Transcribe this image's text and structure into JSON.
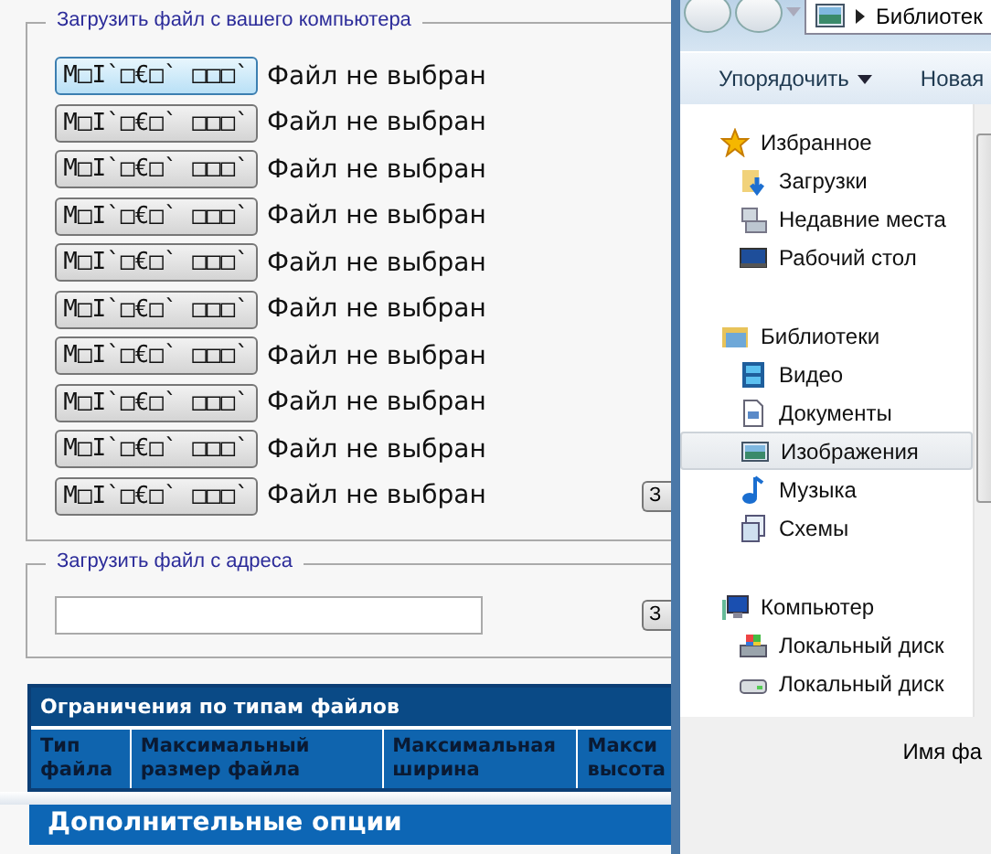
{
  "upload_computer": {
    "legend": "Загрузить файл с вашего компьютера",
    "files": [
      {
        "button": "M□I`□€□` □□□`",
        "status": "Файл не выбран",
        "selected": true
      },
      {
        "button": "M□I`□€□` □□□`",
        "status": "Файл не выбран",
        "selected": false
      },
      {
        "button": "M□I`□€□` □□□`",
        "status": "Файл не выбран",
        "selected": false
      },
      {
        "button": "M□I`□€□` □□□`",
        "status": "Файл не выбран",
        "selected": false
      },
      {
        "button": "M□I`□€□` □□□`",
        "status": "Файл не выбран",
        "selected": false
      },
      {
        "button": "M□I`□€□` □□□`",
        "status": "Файл не выбран",
        "selected": false
      },
      {
        "button": "M□I`□€□` □□□`",
        "status": "Файл не выбран",
        "selected": false
      },
      {
        "button": "M□I`□€□` □□□`",
        "status": "Файл не выбран",
        "selected": false
      },
      {
        "button": "M□I`□€□` □□□`",
        "status": "Файл не выбран",
        "selected": false
      },
      {
        "button": "M□I`□€□` □□□`",
        "status": "Файл не выбран",
        "selected": false
      }
    ],
    "submit": "З"
  },
  "upload_url": {
    "legend": "Загрузить файл с адреса",
    "submit": "З"
  },
  "limits_table": {
    "title": "Ограничения по типам файлов",
    "columns": [
      "Тип файла",
      "Максимальный размер файла",
      "Максимальная ширина",
      "Макси высота"
    ]
  },
  "options_bar": {
    "title": "Дополнительные опции"
  },
  "file_dialog": {
    "breadcrumb": "Библиотек",
    "toolbar": [
      {
        "label": "Упорядочить",
        "dropdown": true
      },
      {
        "label": "Новая",
        "dropdown": false
      }
    ],
    "nav": [
      {
        "label": "Избранное",
        "selected": false,
        "children": [
          {
            "label": "Загрузки",
            "selected": false
          },
          {
            "label": "Недавние места",
            "selected": false
          },
          {
            "label": "Рабочий стол",
            "selected": false
          }
        ]
      },
      {
        "label": "Библиотеки",
        "selected": false,
        "children": [
          {
            "label": "Видео",
            "selected": false
          },
          {
            "label": "Документы",
            "selected": false
          },
          {
            "label": "Изображения",
            "selected": true
          },
          {
            "label": "Музыка",
            "selected": false
          },
          {
            "label": "Схемы",
            "selected": false
          }
        ]
      },
      {
        "label": "Компьютер",
        "selected": false,
        "children": [
          {
            "label": "Локальный диск",
            "selected": false
          },
          {
            "label": "Локальный диск",
            "selected": false
          }
        ]
      }
    ],
    "filename_label": "Имя фа"
  }
}
